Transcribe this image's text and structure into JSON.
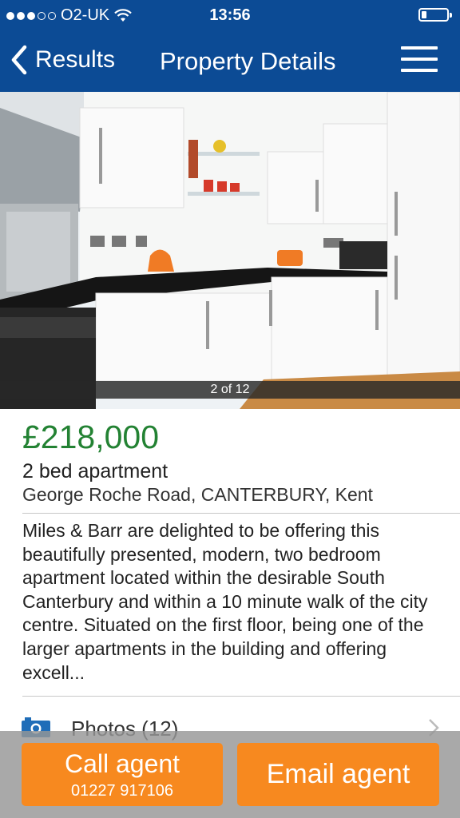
{
  "status_bar": {
    "carrier": "O2-UK",
    "time": "13:56",
    "signal_icon": "signal-dots-icon",
    "wifi_icon": "wifi-icon",
    "battery_icon": "battery-icon"
  },
  "nav": {
    "back_label": "Results",
    "title": "Property Details",
    "menu_icon": "hamburger-menu-icon"
  },
  "gallery": {
    "counter": "2 of 12"
  },
  "property": {
    "price": "£218,000",
    "type": "2 bed apartment",
    "address": "George Roche Road, CANTERBURY, Kent",
    "description": "Miles & Barr are delighted to be offering this beautifully presented, modern, two bedroom apartment located within the desirable South Canterbury and within a 10 minute walk of the city centre. Situated on the first floor, being one of the larger apartments in the building and offering excell..."
  },
  "photos_row": {
    "label": "Photos (12)",
    "icon": "camera-icon"
  },
  "actions": {
    "call_label": "Call agent",
    "call_number": "01227 917106",
    "email_label": "Email agent"
  },
  "colors": {
    "brand_blue": "#0c4b95",
    "price_green": "#238233",
    "action_orange": "#f7891f"
  }
}
